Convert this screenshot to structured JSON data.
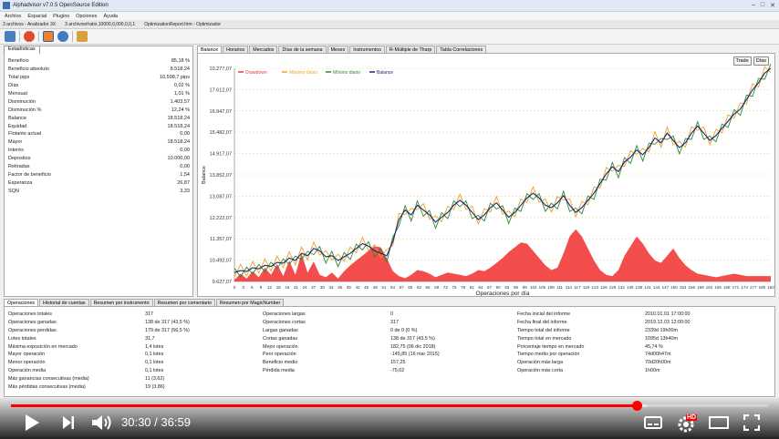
{
  "window": {
    "title": "Alphadvisor v7.0.5 OpenSource Edition"
  },
  "menu": [
    "Archivo",
    "Espacial",
    "Plugins",
    "Opciones",
    "Ayuda"
  ],
  "documents": [
    "3 archivos - Analizador 3X",
    "3 archivos#ratio,10000,0,000,0,0,1",
    "OptimizationReport.htm - Optimizador"
  ],
  "left_tab": "Estadísticas",
  "stats": [
    {
      "label": "Beneficio",
      "value": "85,18 %"
    },
    {
      "label": "Beneficio absoluto",
      "value": "8.518,24"
    },
    {
      "label": "Total pips",
      "value": "10.598,7 pips"
    },
    {
      "label": "Días",
      "value": "0,02 %"
    },
    {
      "label": "Mensual",
      "value": "1,01 %"
    },
    {
      "label": "Disminución",
      "value": "1.403,57"
    },
    {
      "label": "Disminución %",
      "value": "12,24 %"
    },
    {
      "label": "Balance",
      "value": "18.518,24"
    },
    {
      "label": "Equidad",
      "value": "18.518,24"
    },
    {
      "label": "Flotante actual",
      "value": "0,00"
    },
    {
      "label": "Mayor",
      "value": "18.518,24"
    },
    {
      "label": "Interés",
      "value": "0,00"
    },
    {
      "label": "Depositos",
      "value": "10.000,00"
    },
    {
      "label": "Retiradas",
      "value": "0,00"
    },
    {
      "label": "Factor de beneficio",
      "value": "1,54"
    },
    {
      "label": "Esperanza",
      "value": "26,87"
    },
    {
      "label": "SQN",
      "value": "3,33"
    }
  ],
  "right_tabs": [
    "Balance",
    "Horarios",
    "Mercados",
    "Días de la semana",
    "Meses",
    "Instrumentos",
    "R-Múltiple de Tharp",
    "Tabla Correlaciones"
  ],
  "chart_buttons": [
    "Trade",
    "Días"
  ],
  "bottom_tabs": [
    "Operaciones",
    "Historial de cuentas",
    "Resumen por instrumento",
    "Resumen por comentario",
    "Resumen por MagicNumber"
  ],
  "summary_col1": [
    {
      "label": "Operaciones totales",
      "value": "317"
    },
    {
      "label": "Operaciones ganadas",
      "value": "138 de 317 (43,5 %)"
    },
    {
      "label": "Operaciones perdidas",
      "value": "179 de 317 (56,5 %)"
    },
    {
      "label": "Lotes totales",
      "value": "31,7"
    },
    {
      "label": "Máxima exposición en mercado",
      "value": "1,4 lotes"
    },
    {
      "label": "Mayor operación",
      "value": "0,1 lotes"
    },
    {
      "label": "Menor operación",
      "value": "0,1 lotes"
    },
    {
      "label": "Operación media",
      "value": "0,1 lotes"
    },
    {
      "label": "Más ganancias consecutivas (media)",
      "value": "11 (3,62)"
    },
    {
      "label": "Más pérdidas consecutivas (media)",
      "value": "19 (3,86)"
    }
  ],
  "summary_col2": [
    {
      "label": "Operaciones largas",
      "value": "0"
    },
    {
      "label": "Operaciones cortas",
      "value": "317"
    },
    {
      "label": "Largas ganadas",
      "value": "0 de 0 (0 %)"
    },
    {
      "label": "Cortas ganadas",
      "value": "138 de 317 (43,5 %)"
    },
    {
      "label": "Mejor operación",
      "value": "182,75     (06 dic 2018)"
    },
    {
      "label": "Peor operación",
      "value": "-145,85     (16 mar 2015)"
    },
    {
      "label": "Beneficio medio",
      "value": "157,25"
    },
    {
      "label": "Pérdida media",
      "value": "-75,02"
    }
  ],
  "summary_col3": [
    {
      "label": "Fecha inicial del informe",
      "value": "2010.01.01 17:00:00"
    },
    {
      "label": "Fecha final del informe",
      "value": "2019.12.03 12:00:00"
    },
    {
      "label": "Tiempo total del informe",
      "value": "2339d 19h00m"
    },
    {
      "label": "Tiempo total en mercado",
      "value": "1095d 13h40m"
    },
    {
      "label": "Porcentaje tiempo en mercado",
      "value": "45,74 %"
    },
    {
      "label": "Tiempo medio por operación",
      "value": "74d00h47m"
    },
    {
      "label": "Operación más larga",
      "value": "70d20h00m"
    },
    {
      "label": "Operación más corta",
      "value": "1h00m"
    }
  ],
  "player": {
    "current": "30:30",
    "total": "36:59",
    "played": 0.826,
    "buffered": 0.84,
    "hd_badge": "HD"
  },
  "chart_data": {
    "type": "line",
    "xlabel": "Operaciones por día",
    "ylabel": "Balance",
    "y_ticks": [
      "10.277,07",
      "17.612,07",
      "16.947,07",
      "15.482,07",
      "14.917,07",
      "13.852,07",
      "13.087,07",
      "12.222,07",
      "11.357,07",
      "10.492,07",
      "9.627,07"
    ],
    "legend": [
      "Drawdown",
      "Máximo diario",
      "Mínimo diario",
      "Balance"
    ],
    "x_ticks": [
      0,
      3,
      6,
      9,
      12,
      15,
      18,
      21,
      24,
      27,
      30,
      33,
      36,
      39,
      42,
      45,
      48,
      51,
      54,
      57,
      60,
      63,
      66,
      69,
      72,
      75,
      78,
      81,
      84,
      87,
      90,
      93,
      96,
      99,
      102,
      105,
      108,
      111,
      114,
      117,
      120,
      123,
      126,
      129,
      132,
      135,
      138,
      141,
      144,
      147,
      150,
      153,
      156,
      159,
      162,
      165,
      168,
      171,
      174,
      177,
      180,
      183
    ],
    "ylim": [
      9627,
      18500
    ],
    "series": [
      {
        "name": "Balance",
        "values": [
          10000,
          10080,
          10040,
          10200,
          10150,
          10300,
          10250,
          10420,
          10380,
          10600,
          10500,
          10800,
          10700,
          11000,
          10900,
          10650,
          10700,
          10500,
          10650,
          10800,
          11000,
          11200,
          11100,
          10900,
          10800,
          10700,
          11300,
          12200,
          12600,
          12400,
          12800,
          12600,
          12400,
          12100,
          12300,
          12500,
          12800,
          13000,
          12800,
          12500,
          12200,
          12400,
          12700,
          12900,
          12600,
          12300,
          12500,
          12800,
          13100,
          13300,
          13100,
          12800,
          12700,
          12900,
          13200,
          12800,
          12500,
          12700,
          13000,
          13300,
          13700,
          14100,
          14400,
          14200,
          14600,
          14800,
          15100,
          14900,
          15200,
          15600,
          15400,
          15800,
          15500,
          15200,
          15400,
          15800,
          16100,
          15800,
          15500,
          15700,
          16000,
          16300,
          16600,
          16800,
          17200,
          17600,
          17900,
          18300,
          18500
        ]
      },
      {
        "name": "Drawdown",
        "values": [
          9700,
          9950,
          9750,
          10050,
          9800,
          10200,
          9900,
          10350,
          9850,
          10500,
          9900,
          10800,
          10000,
          10450,
          9900,
          9800,
          10000,
          9750,
          10050,
          10300,
          10500,
          10700,
          10900,
          11100,
          11050,
          10600,
          10050,
          9850,
          9760,
          9900,
          10100,
          10050,
          9950,
          9800,
          9900,
          10000,
          9950,
          9900,
          9850,
          9950,
          10100,
          10050,
          10200,
          10400,
          10600,
          10850,
          11050,
          11250,
          11200,
          10900,
          10600,
          10300,
          10100,
          10200,
          10800,
          11500,
          11800,
          11500,
          11000,
          10500,
          10100,
          9900,
          9850,
          10100,
          10700,
          11100,
          11500,
          11200,
          10800,
          10500,
          10400,
          10700,
          11000,
          10600,
          10300,
          10100,
          9950,
          9900,
          9850,
          9800,
          9850,
          9900,
          9950,
          9900,
          9850,
          9850,
          9850,
          9850,
          9850
        ]
      }
    ]
  }
}
